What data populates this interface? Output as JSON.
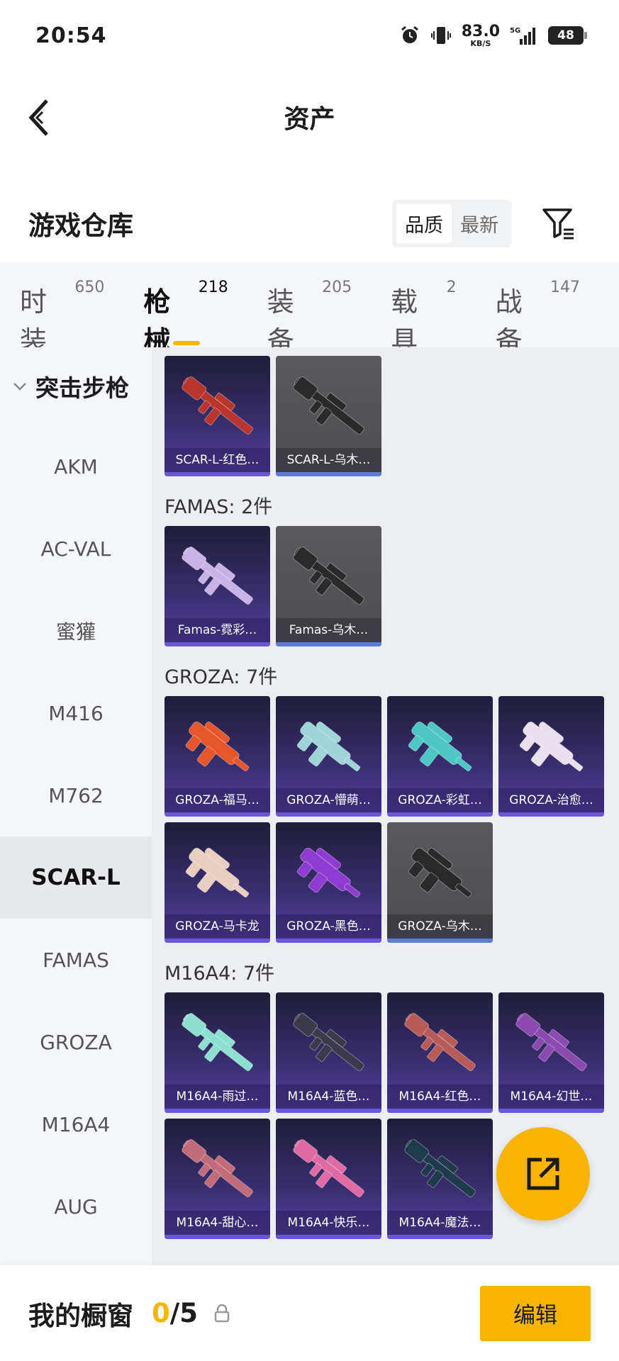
{
  "status": {
    "time": "20:54",
    "net_speed": "83.0",
    "net_unit": "KB/S",
    "net_label": "5G",
    "battery": "48"
  },
  "header": {
    "title": "资产"
  },
  "warehouse": {
    "title": "游戏仓库",
    "sort_quality": "品质",
    "sort_latest": "最新"
  },
  "tabs": [
    {
      "label": "时装",
      "count": "650"
    },
    {
      "label": "枪械",
      "count": "218"
    },
    {
      "label": "装备",
      "count": "205"
    },
    {
      "label": "载具",
      "count": "2"
    },
    {
      "label": "战备",
      "count": "147"
    }
  ],
  "sidebar": {
    "category": "突击步枪",
    "items": [
      "AKM",
      "AC-VAL",
      "蜜獾",
      "M416",
      "M762",
      "SCAR-L",
      "FAMAS",
      "GROZA",
      "M16A4",
      "AUG"
    ]
  },
  "groups": [
    {
      "title": "",
      "items": [
        {
          "name": "SCAR-L-红色…",
          "color": "#b8342d"
        },
        {
          "name": "SCAR-L-乌木…",
          "color": "#2a2a2a"
        }
      ]
    },
    {
      "title": "FAMAS: 2件",
      "items": [
        {
          "name": "Famas-霓彩…",
          "color": "#c7b4e6"
        },
        {
          "name": "Famas-乌木…",
          "color": "#2a2a2a"
        }
      ]
    },
    {
      "title": "GROZA: 7件",
      "items": [
        {
          "name": "GROZA-福马…",
          "color": "#e5562a"
        },
        {
          "name": "GROZA-懵萌…",
          "color": "#9fd4d8"
        },
        {
          "name": "GROZA-彩虹…",
          "color": "#4ec7c6"
        },
        {
          "name": "GROZA-治愈…",
          "color": "#e8e0ec"
        },
        {
          "name": "GROZA-马卡龙",
          "color": "#e9cfc0"
        },
        {
          "name": "GROZA-黑色…",
          "color": "#8f3bd1"
        },
        {
          "name": "GROZA-乌木…",
          "color": "#2a2a2a"
        }
      ]
    },
    {
      "title": "M16A4: 7件",
      "items": [
        {
          "name": "M16A4-雨过…",
          "color": "#8de0cf"
        },
        {
          "name": "M16A4-蓝色…",
          "color": "#3b3a4a"
        },
        {
          "name": "M16A4-红色…",
          "color": "#b85b58"
        },
        {
          "name": "M16A4-幻世…",
          "color": "#8a4ab0"
        },
        {
          "name": "M16A4-甜心…",
          "color": "#c26b7a"
        },
        {
          "name": "M16A4-快乐…",
          "color": "#e06aa3"
        },
        {
          "name": "M16A4-魔法…",
          "color": "#1f3a4a"
        }
      ]
    }
  ],
  "showcase": {
    "label": "我的橱窗",
    "current": "0",
    "total": "/5",
    "edit": "编辑"
  },
  "colors": {
    "accent": "#f7b500",
    "card_purple": "#3a2f72",
    "card_gray": "#505055"
  }
}
